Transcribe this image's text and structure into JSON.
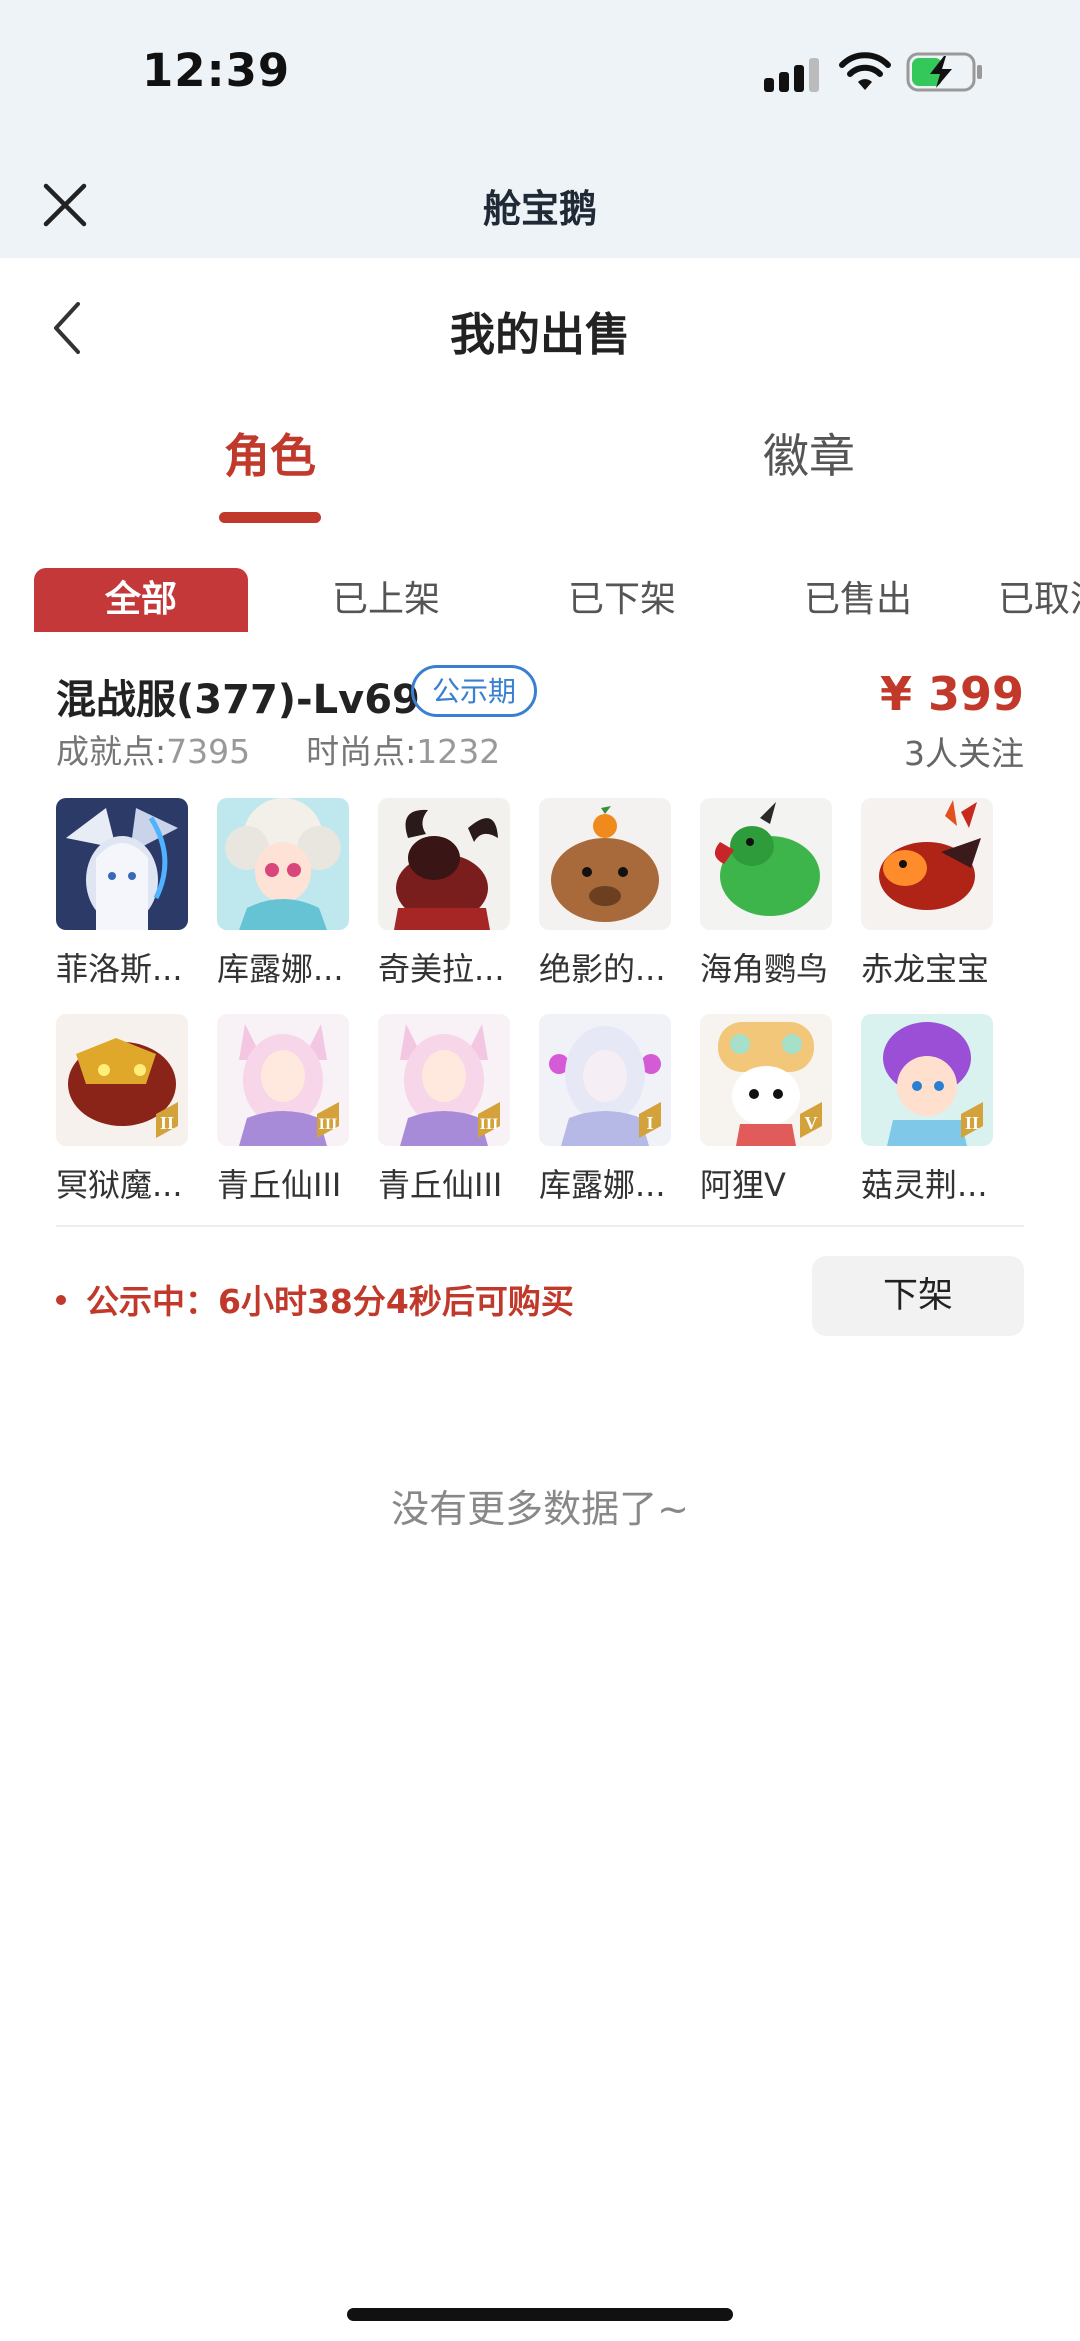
{
  "status_bar": {
    "time": "12:39"
  },
  "webview": {
    "title": "舱宝鹅"
  },
  "page": {
    "title": "我的出售"
  },
  "tabs": [
    {
      "label": "角色",
      "selected": true
    },
    {
      "label": "徽章",
      "selected": false
    }
  ],
  "filters": [
    "全部",
    "已上架",
    "已下架",
    "已售出",
    "已取消"
  ],
  "listing": {
    "server": "混战服(377)-Lv69",
    "tag": "公示期",
    "price": "¥ 399",
    "achievement_label": "成就点:",
    "achievement_value": "7395",
    "fashion_label": "时尚点:",
    "fashion_value": "1232",
    "followers": "3人关注",
    "items": [
      {
        "label": "菲洛斯...",
        "icon": "white-dragon-hero-icon"
      },
      {
        "label": "库露娜...",
        "icon": "fluffy-girl-icon"
      },
      {
        "label": "奇美拉...",
        "icon": "chimera-beast-icon"
      },
      {
        "label": "绝影的...",
        "icon": "capybara-icon"
      },
      {
        "label": "海角鹦鸟",
        "icon": "green-parrot-icon"
      },
      {
        "label": "赤龙宝宝",
        "icon": "red-baby-dragon-icon"
      },
      {
        "label": "冥狱魔...",
        "icon": "golden-dragon-icon",
        "rank": "II"
      },
      {
        "label": "青丘仙III",
        "icon": "fox-fairy-icon",
        "rank": "III"
      },
      {
        "label": "青丘仙III",
        "icon": "fox-fairy-icon",
        "rank": "III"
      },
      {
        "label": "库露娜...",
        "icon": "silver-girl-icon",
        "rank": "I"
      },
      {
        "label": "阿狸V",
        "icon": "bear-hat-icon",
        "rank": "V"
      },
      {
        "label": "菇灵荆...",
        "icon": "purple-hair-icon",
        "rank": "II"
      }
    ],
    "notice": "公示中：6小时38分4秒后可购买",
    "delist_label": "下架"
  },
  "footer": {
    "no_more": "没有更多数据了~"
  },
  "colors": {
    "accent": "#c0392b",
    "tag_blue": "#3a7fd1",
    "header_bg": "#eef3f7"
  }
}
